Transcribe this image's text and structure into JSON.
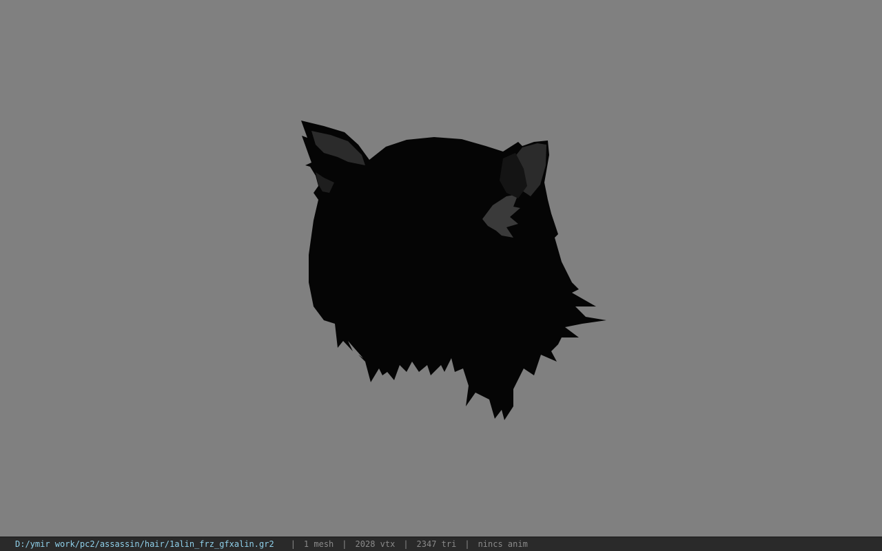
{
  "viewport": {
    "background_color": "#808080",
    "model_color": "#050505",
    "model_highlight_color": "#2b2b2b",
    "model_icon": "hair-mesh"
  },
  "status_bar": {
    "file_path": "D:/ymir work/pc2/assassin/hair/1alin_frz_gfxalin.gr2",
    "separator": "|",
    "mesh_count": "1 mesh",
    "vertex_count": "2028 vtx",
    "triangle_count": "2347 tri",
    "anim_status": "nincs anim",
    "path_color": "#8fd0ea",
    "text_color": "#8a8a8a"
  }
}
